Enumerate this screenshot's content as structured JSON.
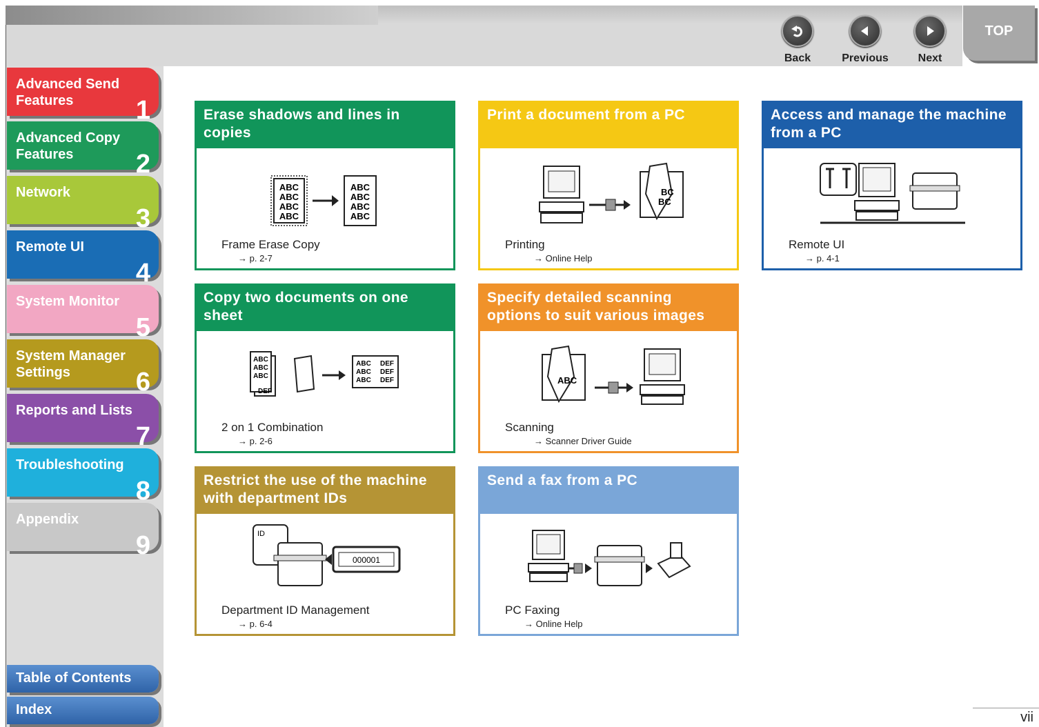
{
  "nav": {
    "back": "Back",
    "previous": "Previous",
    "next": "Next",
    "top": "TOP"
  },
  "chapters": [
    {
      "label": "Advanced Send\nFeatures",
      "num": "1",
      "color": "#e8383d"
    },
    {
      "label": "Advanced Copy\nFeatures",
      "num": "2",
      "color": "#1e9a5a"
    },
    {
      "label": "Network",
      "num": "3",
      "color": "#a8c83a"
    },
    {
      "label": "Remote UI",
      "num": "4",
      "color": "#1a6db5"
    },
    {
      "label": "System Monitor",
      "num": "5",
      "color": "#f2a7c3"
    },
    {
      "label": "System Manager\nSettings",
      "num": "6",
      "color": "#b59a1e"
    },
    {
      "label": "Reports and Lists",
      "num": "7",
      "color": "#8b4fa8"
    },
    {
      "label": "Troubleshooting",
      "num": "8",
      "color": "#1fb0dc"
    },
    {
      "label": "Appendix",
      "num": "9",
      "color": "#c8c8c8"
    }
  ],
  "bottom_tabs": {
    "toc": "Table of Contents",
    "index": "Index"
  },
  "cards": [
    {
      "title": "Erase shadows and lines in copies",
      "label": "Frame Erase Copy",
      "ref": "→  p. 2-7",
      "color": "#11955a"
    },
    {
      "title": "Print a document from a PC",
      "label": "Printing",
      "ref": "→  Online Help",
      "color": "#f5c814"
    },
    {
      "title": "Access and manage the machine from a PC",
      "label": "Remote UI",
      "ref": "→  p. 4-1",
      "color": "#1d5faa"
    },
    {
      "title": "Copy two documents on one sheet",
      "label": "2 on 1 Combination",
      "ref": "→  p. 2-6",
      "color": "#11955a"
    },
    {
      "title": "Specify detailed scanning options to suit various images",
      "label": "Scanning",
      "ref": "→  Scanner Driver Guide",
      "color": "#f0922a"
    },
    {
      "title": "Restrict the use of the machine with department IDs",
      "label": "Department ID Management",
      "ref": "→  p. 6-4",
      "color": "#b59435"
    },
    {
      "title": "Send a fax from a PC",
      "label": "PC Faxing",
      "ref": "→  Online Help",
      "color": "#7aa6d8"
    }
  ],
  "illus_text": {
    "abc": "ABC",
    "bc": "BC",
    "def": "DEF",
    "id": "ID",
    "counter": "000001"
  },
  "page_number": "vii"
}
